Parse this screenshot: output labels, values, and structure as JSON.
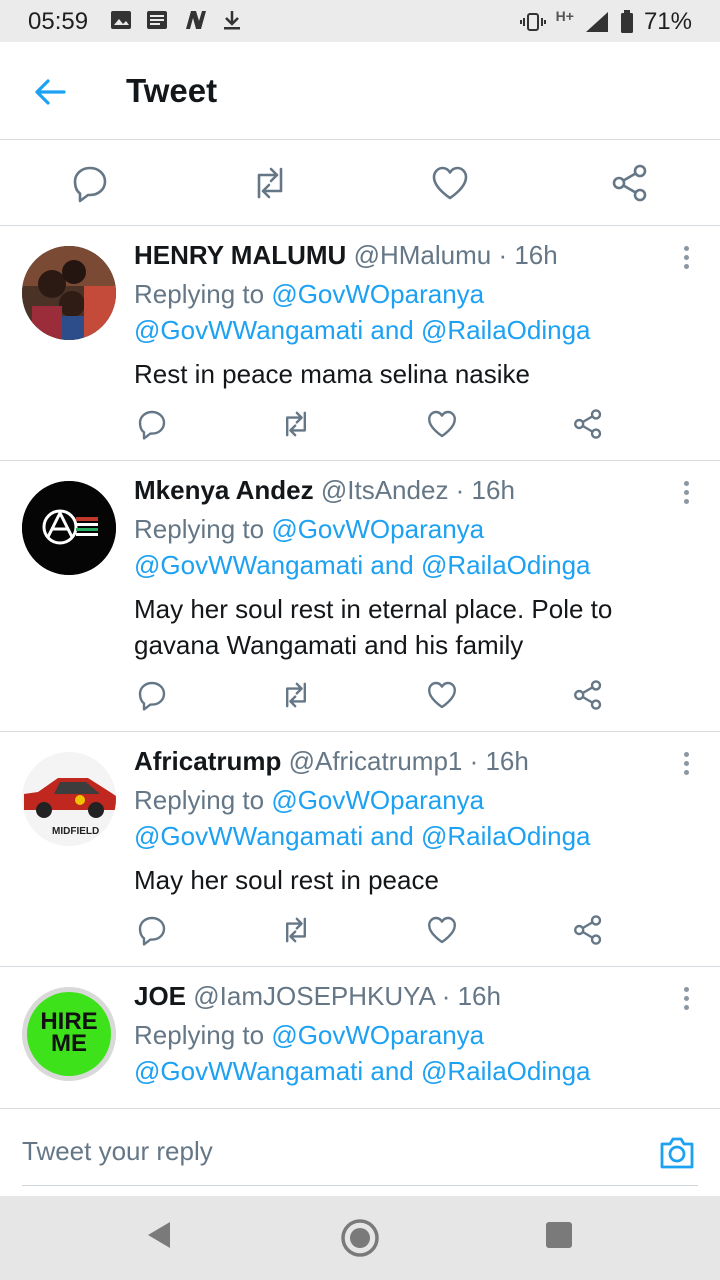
{
  "status_bar": {
    "time": "05:59",
    "battery": "71%",
    "network": "H+"
  },
  "header": {
    "title": "Tweet"
  },
  "colors": {
    "accent": "#1da1f2",
    "text": "#14171a",
    "muted": "#657786",
    "divider": "#d6dbdf"
  },
  "replies": [
    {
      "name": "HENRY MALUMU",
      "meta": "@HMalumu · 16h",
      "replying_prefix": "Replying to",
      "mention1": "@GovWOparanya",
      "mention2": "@GovWWangamati",
      "and": "and",
      "mention3": "@RailaOdinga",
      "text": "Rest in peace mama selina nasike"
    },
    {
      "name": "Mkenya Andez",
      "meta": "@ItsAndez · 16h",
      "replying_prefix": "Replying to",
      "mention1": "@GovWOparanya",
      "mention2": "@GovWWangamati",
      "and": "and",
      "mention3": "@RailaOdinga",
      "text": "May her soul rest in eternal place. Pole to gavana Wangamati and his family"
    },
    {
      "name": "Africatrump",
      "meta": "@Africatrump1 · 16h",
      "replying_prefix": "Replying to",
      "mention1": "@GovWOparanya",
      "mention2": "@GovWWangamati",
      "and": "and",
      "mention3": "@RailaOdinga",
      "text": "May her soul rest in peace",
      "avatar_caption": "MIDFIELD"
    },
    {
      "name": "JOE",
      "meta": "@IamJOSEPHKUYA · 16h",
      "replying_prefix": "Replying to",
      "mention1": "@GovWOparanya",
      "mention2": "@GovWWangamati",
      "and": "and",
      "mention3": "@RailaOdinga",
      "avatar_text": "HIRE ME"
    }
  ],
  "reply_bar": {
    "placeholder": "Tweet your reply"
  },
  "icons": {
    "reply": "reply-icon",
    "retweet": "retweet-icon",
    "like": "heart-icon",
    "share": "share-icon",
    "back": "arrow-left-icon",
    "camera": "camera-icon"
  }
}
